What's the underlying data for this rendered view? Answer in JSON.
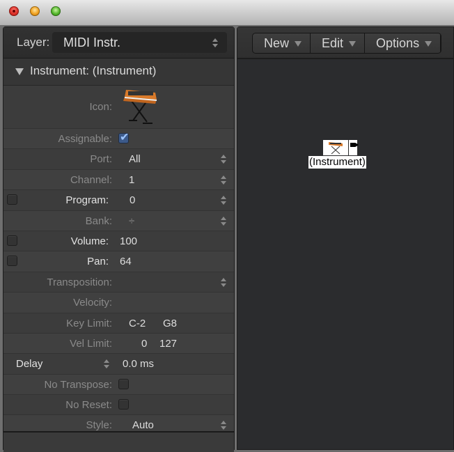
{
  "window": {
    "controls": [
      "close",
      "minimize",
      "zoom"
    ]
  },
  "inspector": {
    "layer_label": "Layer:",
    "layer_value": "MIDI Instr.",
    "section_title": "Instrument: (Instrument)",
    "icon_label": "Icon:",
    "icon_name": "synthesizer-on-stand-icon",
    "rows": {
      "assignable": {
        "label": "Assignable:",
        "checked": true
      },
      "port": {
        "label": "Port:",
        "value": "All"
      },
      "channel": {
        "label": "Channel:",
        "value": "1"
      },
      "program": {
        "label": "Program:",
        "value": "0",
        "enabled": false
      },
      "bank": {
        "label": "Bank:",
        "value": "÷"
      },
      "volume": {
        "label": "Volume:",
        "value": "100",
        "enabled": false
      },
      "pan": {
        "label": "Pan:",
        "value": "64",
        "enabled": false
      },
      "transposition": {
        "label": "Transposition:",
        "value": ""
      },
      "velocity": {
        "label": "Velocity:",
        "value": ""
      },
      "key_limit": {
        "label": "Key Limit:",
        "low": "C-2",
        "high": "G8"
      },
      "vel_limit": {
        "label": "Vel Limit:",
        "low": "0",
        "high": "127"
      },
      "delay": {
        "label": "Delay",
        "value": "0.0 ms"
      },
      "no_transpose": {
        "label": "No Transpose:",
        "checked": false
      },
      "no_reset": {
        "label": "No Reset:",
        "checked": false
      },
      "style": {
        "label": "Style:",
        "value": "Auto"
      }
    }
  },
  "environment": {
    "menus": [
      {
        "label": "New"
      },
      {
        "label": "Edit"
      },
      {
        "label": "Options"
      }
    ],
    "objects": [
      {
        "label": "(Instrument)",
        "icon": "synthesizer-icon"
      }
    ]
  }
}
